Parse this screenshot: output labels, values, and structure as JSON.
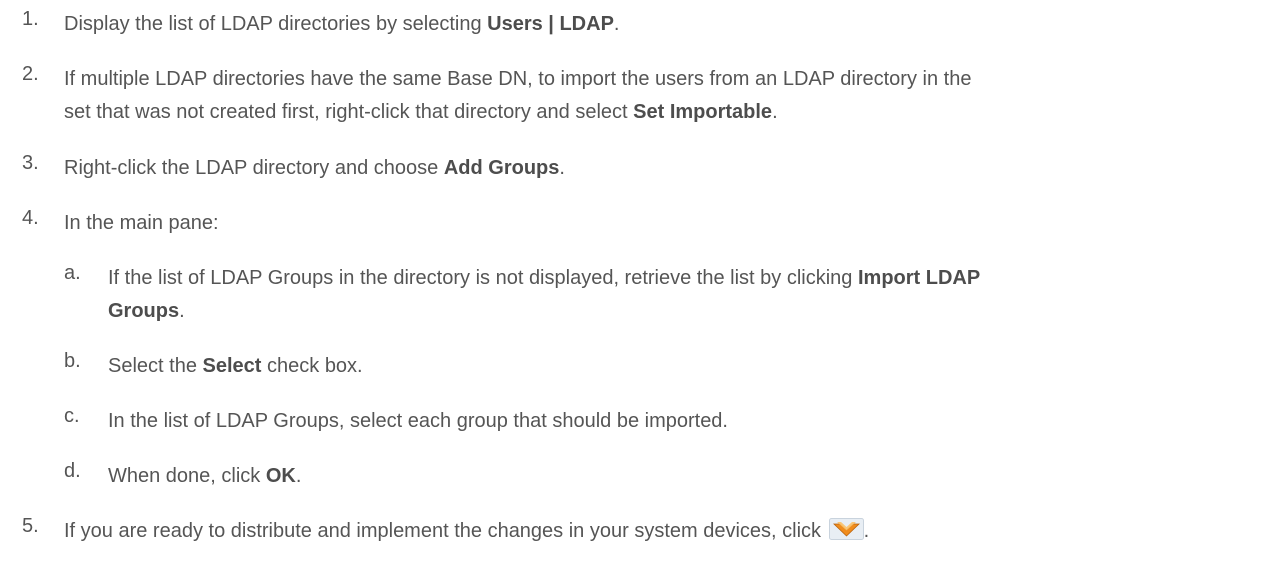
{
  "steps": [
    {
      "num": "1.",
      "parts": [
        "Display the list of LDAP directories by selecting ",
        "Users | LDAP",
        "."
      ]
    },
    {
      "num": "2.",
      "line1": "If multiple LDAP directories have the same Base DN, to import the users from an LDAP directory in the",
      "line2_parts": [
        "set that was not created first, right-click that directory and select ",
        "Set Importable",
        "."
      ]
    },
    {
      "num": "3.",
      "parts": [
        "Right-click the LDAP directory and choose ",
        "Add Groups",
        "."
      ]
    },
    {
      "num": "4.",
      "text": "In the main pane:"
    },
    {
      "num": "5.",
      "parts": [
        "If you are ready to distribute and implement the changes in your system devices, click ",
        "."
      ],
      "icon": "install-policy-icon"
    }
  ],
  "substeps": [
    {
      "num": "a.",
      "line1_parts": [
        "If the list of LDAP Groups in the directory is not displayed, retrieve the list by clicking ",
        "Import LDAP"
      ],
      "line2_parts": [
        "Groups",
        "."
      ]
    },
    {
      "num": "b.",
      "parts": [
        "Select the ",
        "Select",
        " check box."
      ]
    },
    {
      "num": "c.",
      "text": "In the list of LDAP Groups, select each group that should be imported."
    },
    {
      "num": "d.",
      "parts": [
        "When done, click ",
        "OK",
        "."
      ]
    }
  ],
  "colors": {
    "text": "#555555",
    "icon_orange": "#f08c1c",
    "icon_bg": "#e8eef4"
  }
}
